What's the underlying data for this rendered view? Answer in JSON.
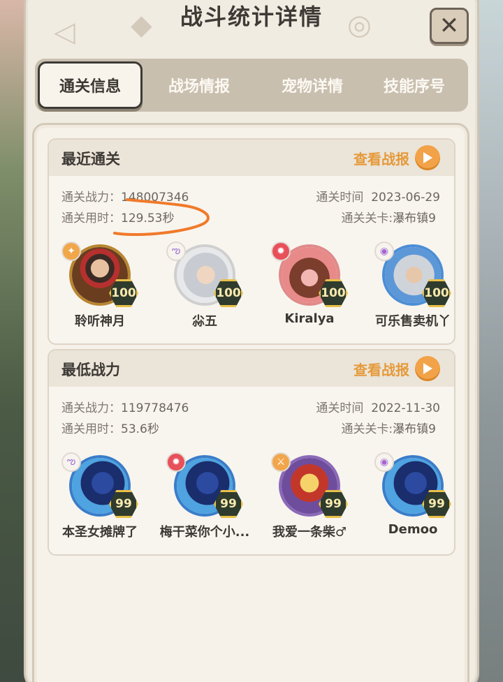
{
  "header": {
    "title": "战斗统计详情",
    "close_icon": "close-icon"
  },
  "tabs": [
    {
      "label": "通关信息",
      "active": true
    },
    {
      "label": "战场情报",
      "active": false
    },
    {
      "label": "宠物详情",
      "active": false
    },
    {
      "label": "技能序号",
      "active": false
    }
  ],
  "sections": [
    {
      "title": "最近通关",
      "report_label": "查看战报",
      "power_label": "通关战力：",
      "power": "148007346",
      "time_label": "通关用时：",
      "time": "129.53秒",
      "date_label": "通关时间",
      "date": "2023-06-29",
      "stage_label": "通关关卡:",
      "stage": "瀑布镇9",
      "heroes": [
        {
          "name": "聆听神月",
          "level": "100",
          "element": "fire"
        },
        {
          "name": "尛五",
          "level": "100",
          "element": "wind"
        },
        {
          "name": "Kiralya",
          "level": "100",
          "element": "fire"
        },
        {
          "name": "可乐售卖机丫",
          "level": "100",
          "element": "dark"
        }
      ]
    },
    {
      "title": "最低战力",
      "report_label": "查看战报",
      "power_label": "通关战力：",
      "power": "119778476",
      "time_label": "通关用时：",
      "time": "53.6秒",
      "date_label": "通关时间",
      "date": "2022-11-30",
      "stage_label": "通关关卡:",
      "stage": "瀑布镇9",
      "heroes": [
        {
          "name": "本圣女摊牌了",
          "level": "99",
          "element": "wind"
        },
        {
          "name": "梅干菜你个小...",
          "level": "99",
          "element": "fire"
        },
        {
          "name": "我爱一条柴♂",
          "level": "99",
          "element": "light"
        },
        {
          "name": "Demoo",
          "level": "99",
          "element": "dark"
        }
      ]
    }
  ],
  "colors": {
    "accent": "#e59a3b",
    "annotation": "#f07a2a",
    "panel": "#f1ece2"
  }
}
